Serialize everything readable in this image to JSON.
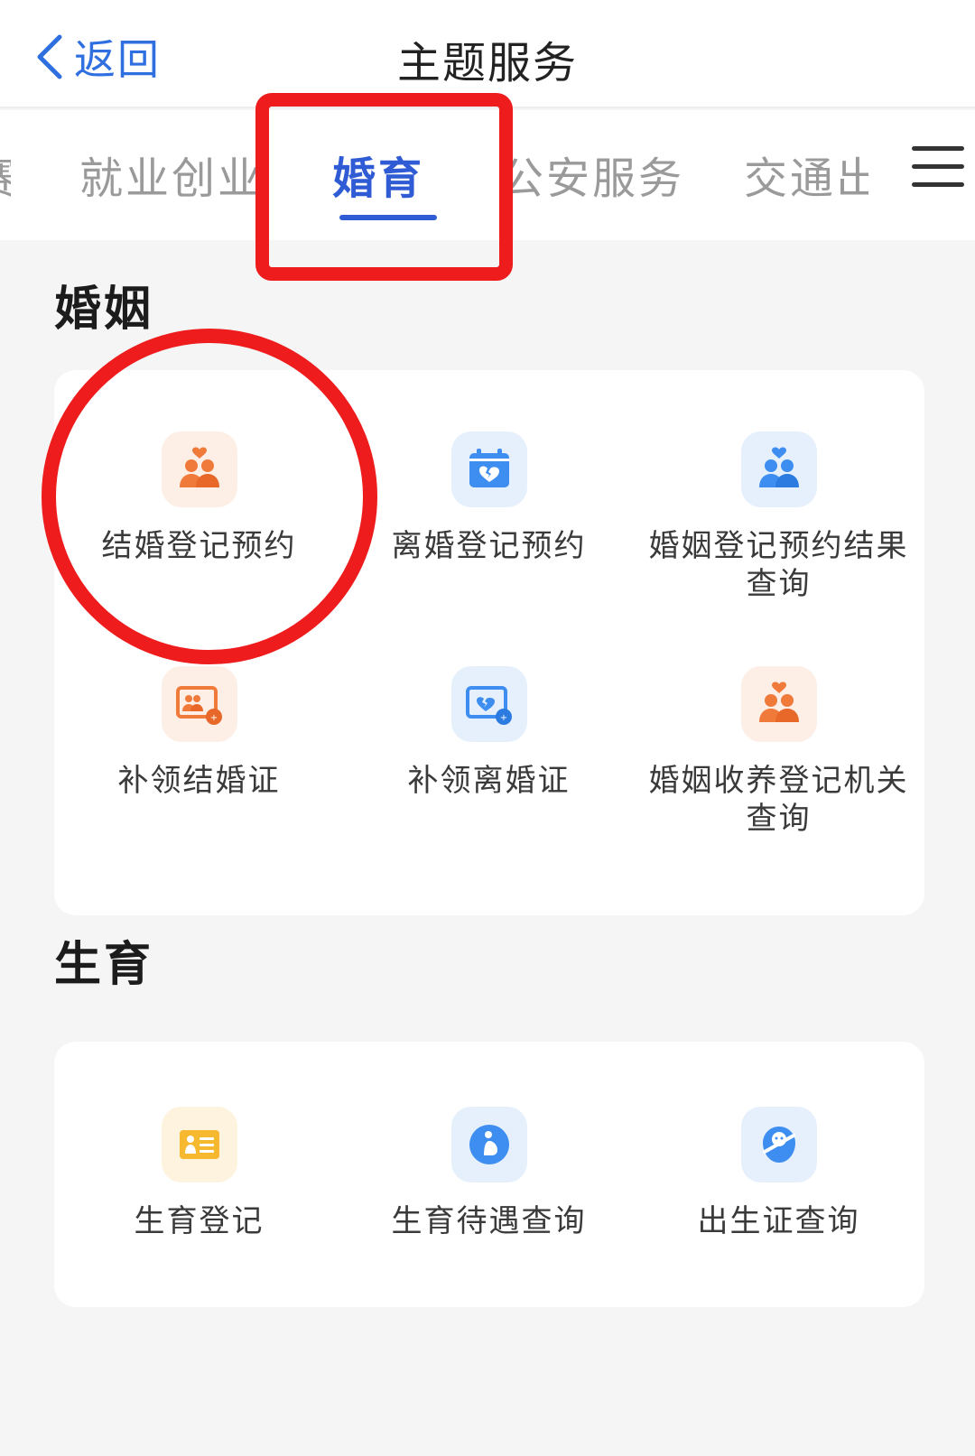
{
  "header": {
    "back_label": "返回",
    "title": "主题服务"
  },
  "tabs": [
    {
      "label": "赛",
      "active": false
    },
    {
      "label": "就业创业",
      "active": false
    },
    {
      "label": "婚育",
      "active": true
    },
    {
      "label": "公安服务",
      "active": false
    },
    {
      "label": "交通出行",
      "active": false
    }
  ],
  "sections": [
    {
      "title": "婚姻",
      "items": [
        {
          "label": "结婚登记预约",
          "icon": "couple-heart-icon",
          "tint": "orange"
        },
        {
          "label": "离婚登记预约",
          "icon": "calendar-broken-heart-icon",
          "tint": "blue"
        },
        {
          "label": "婚姻登记预约结果查询",
          "icon": "couple-heart-icon",
          "tint": "blue"
        },
        {
          "label": "补领结婚证",
          "icon": "marriage-certificate-reissue-icon",
          "tint": "orange"
        },
        {
          "label": "补领离婚证",
          "icon": "divorce-certificate-reissue-icon",
          "tint": "blue"
        },
        {
          "label": "婚姻收养登记机关查询",
          "icon": "couple-heart-icon",
          "tint": "orange"
        }
      ]
    },
    {
      "title": "生育",
      "items": [
        {
          "label": "生育登记",
          "icon": "birth-registration-card-icon",
          "tint": "yellow"
        },
        {
          "label": "生育待遇查询",
          "icon": "pregnant-woman-icon",
          "tint": "blue"
        },
        {
          "label": "出生证查询",
          "icon": "birth-certificate-baby-icon",
          "tint": "blue"
        }
      ]
    }
  ],
  "colors": {
    "accent": "#2f5bd4",
    "annotation": "#ee1c1c",
    "icon_orange": "#f07a3a",
    "icon_blue": "#3d8ef0"
  }
}
